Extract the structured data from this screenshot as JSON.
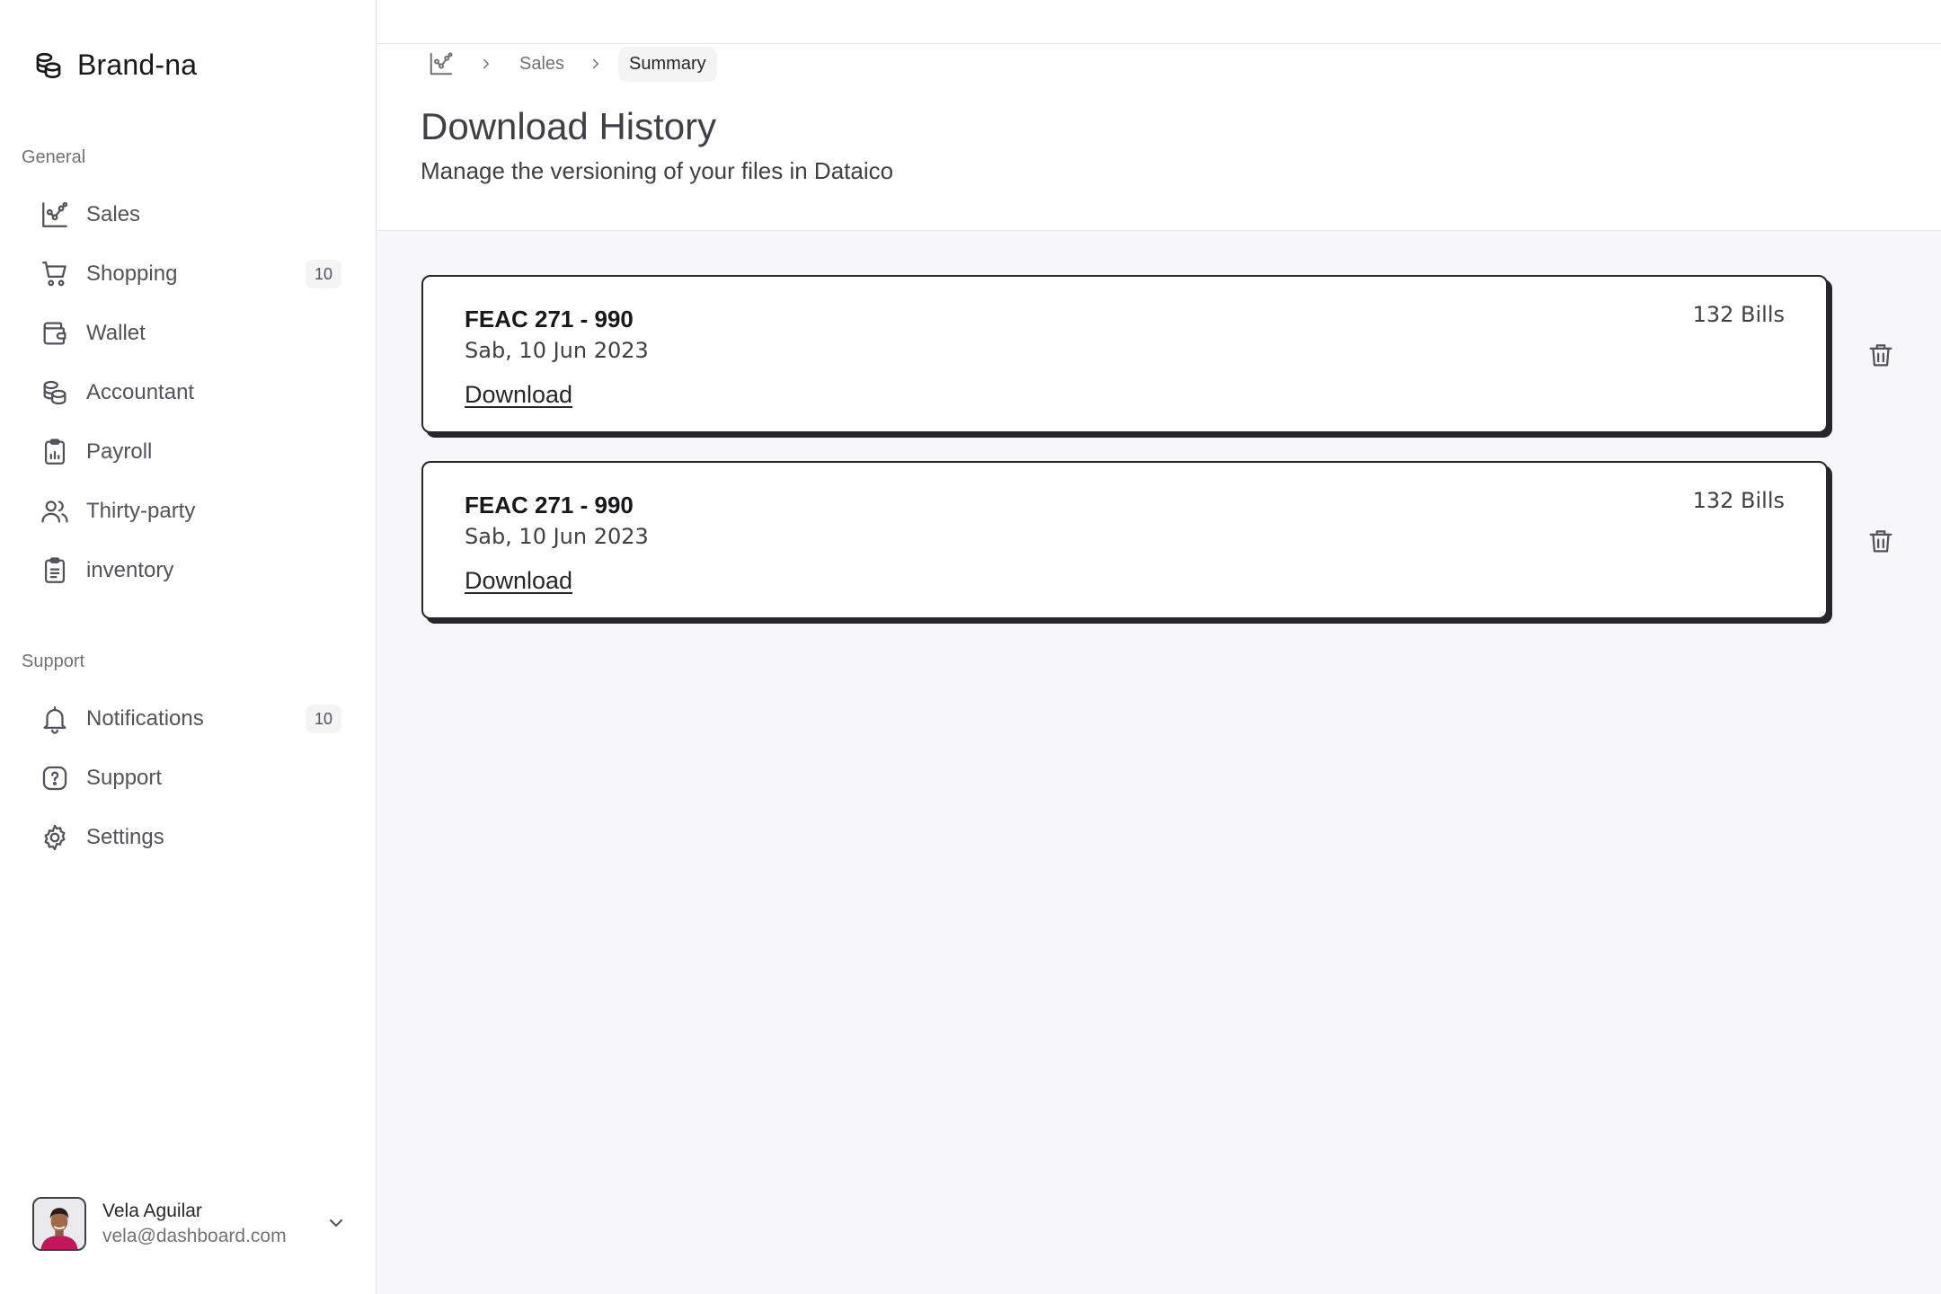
{
  "brand": {
    "name": "Brand-na"
  },
  "sidebar": {
    "general_label": "General",
    "general_items": [
      {
        "label": "Sales",
        "icon": "chart-icon"
      },
      {
        "label": "Shopping",
        "icon": "cart-icon",
        "badge": "10"
      },
      {
        "label": "Wallet",
        "icon": "wallet-icon"
      },
      {
        "label": "Accountant",
        "icon": "coins-icon"
      },
      {
        "label": "Payroll",
        "icon": "clipboard-chart-icon"
      },
      {
        "label": "Thirty-party",
        "icon": "users-icon"
      },
      {
        "label": "inventory",
        "icon": "clipboard-list-icon"
      }
    ],
    "support_label": "Support",
    "support_items": [
      {
        "label": "Notifications",
        "icon": "bell-icon",
        "badge": "10"
      },
      {
        "label": "Support",
        "icon": "help-icon"
      },
      {
        "label": "Settings",
        "icon": "gear-icon"
      }
    ]
  },
  "user": {
    "name": "Vela Aguilar",
    "email": "vela@dashboard.com"
  },
  "breadcrumb": {
    "items": [
      "Sales",
      "Summary"
    ]
  },
  "header": {
    "title": "Download History",
    "subtitle": "Manage the versioning of your files in Dataico"
  },
  "downloads": [
    {
      "title": "FEAC 271 - 990",
      "date": "Sab, 10 Jun 2023",
      "bills": "132 Bills",
      "action": "Download"
    },
    {
      "title": "FEAC 271 - 990",
      "date": "Sab, 10 Jun 2023",
      "bills": "132 Bills",
      "action": "Download"
    }
  ]
}
